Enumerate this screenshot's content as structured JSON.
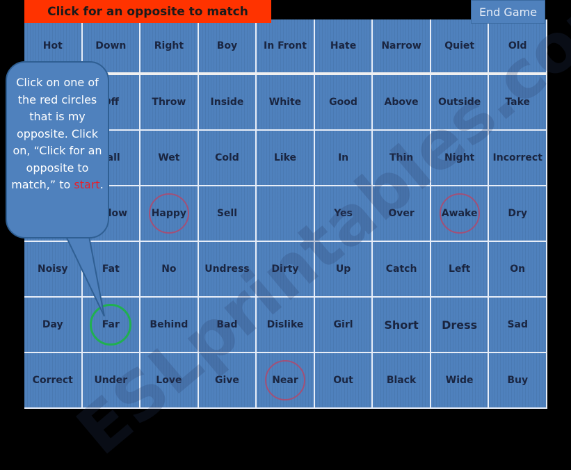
{
  "header": {
    "label": "Click  for an opposite to match"
  },
  "end_game": {
    "label": "End Game"
  },
  "callout": {
    "text": "Click on one of the red circles that is my opposite. Click on, “Click for an opposite to match,” to ",
    "highlight": "start",
    "end": "."
  },
  "watermark": "ESLprintables.com",
  "colors": {
    "grid": "#4f81bd",
    "header": "#ff3300",
    "circle_red": "#c83c5a",
    "circle_green": "#20b050"
  },
  "grid": {
    "rows": [
      [
        "Hot",
        "Down",
        "Right",
        "Boy",
        "In Front",
        "Hate",
        "Narrow",
        "Quiet",
        "Old"
      ],
      [
        "",
        "Off",
        "Throw",
        "Inside",
        "White",
        "Good",
        "Above",
        "Outside",
        "Take"
      ],
      [
        "",
        "Tall",
        "Wet",
        "Cold",
        "Like",
        "In",
        "Thin",
        "Night",
        "Incorrect"
      ],
      [
        "",
        "Below",
        "Happy",
        "Sell",
        "",
        "Yes",
        "Over",
        "Awake",
        "Dry"
      ],
      [
        "Noisy",
        "Fat",
        "No",
        "Undress",
        "Dirty",
        "Up",
        "Catch",
        "Left",
        "On"
      ],
      [
        "Day",
        "Far",
        "Behind",
        "Bad",
        "Dislike",
        "Girl",
        "Short",
        "Dress",
        "Sad"
      ],
      [
        "Correct",
        "Under",
        "Love",
        "Give",
        "Near",
        "Out",
        "Black",
        "Wide",
        "Buy"
      ]
    ],
    "red_circles": [
      "Happy",
      "Awake",
      "Near"
    ],
    "green_circles": [
      "Far"
    ],
    "large_words": [
      "Short",
      "Dress"
    ]
  }
}
